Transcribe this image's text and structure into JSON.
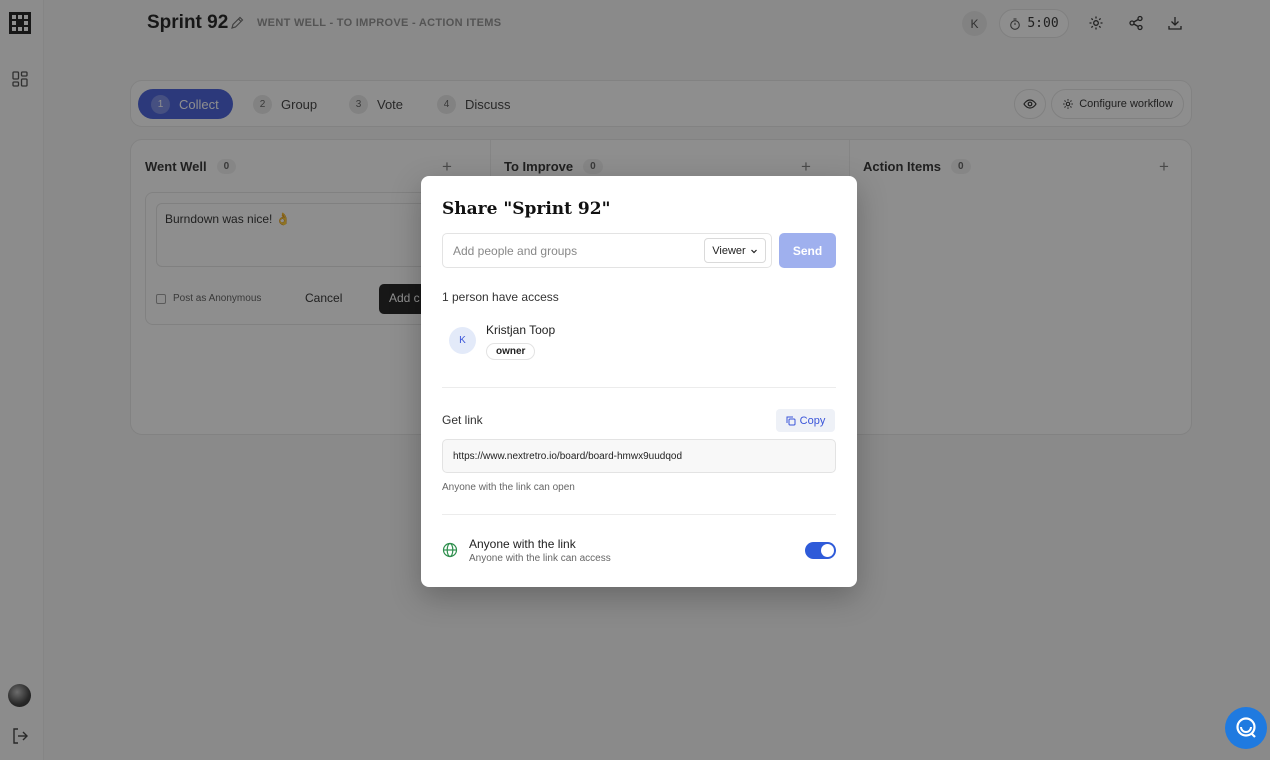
{
  "header": {
    "title": "Sprint 92",
    "subtitle": "WENT WELL - TO IMPROVE - ACTION ITEMS",
    "avatar_initial": "K",
    "timer": "5:00"
  },
  "phases": [
    {
      "num": "1",
      "label": "Collect"
    },
    {
      "num": "2",
      "label": "Group"
    },
    {
      "num": "3",
      "label": "Vote"
    },
    {
      "num": "4",
      "label": "Discuss"
    }
  ],
  "toolbar": {
    "configure_label": "Configure workflow"
  },
  "columns": [
    {
      "title": "Went Well",
      "count": "0"
    },
    {
      "title": "To Improve",
      "count": "0"
    },
    {
      "title": "Action Items",
      "count": "0"
    }
  ],
  "card": {
    "text": "Burndown was nice! 👌",
    "anonymous_label": "Post as Anonymous",
    "cancel_label": "Cancel",
    "add_label": "Add c"
  },
  "modal": {
    "title": "Share \"Sprint 92\"",
    "input_placeholder": "Add people and groups",
    "role": "Viewer",
    "send_label": "Send",
    "access_count": "1 person have access",
    "user": {
      "initial": "K",
      "name": "Kristjan Toop",
      "role": "owner"
    },
    "get_link_label": "Get link",
    "copy_label": "Copy",
    "link_url": "https://www.nextretro.io/board/board-hmwx9uudqod",
    "link_hint": "Anyone with the link can open",
    "anyone_title": "Anyone with the link",
    "anyone_sub": "Anyone with the link can access",
    "toggle_on": true
  },
  "colors": {
    "accent": "#3a55d9",
    "send_disabled": "#9fb0ee",
    "toggle": "#2f5bd9",
    "chat": "#1f7ae0"
  }
}
